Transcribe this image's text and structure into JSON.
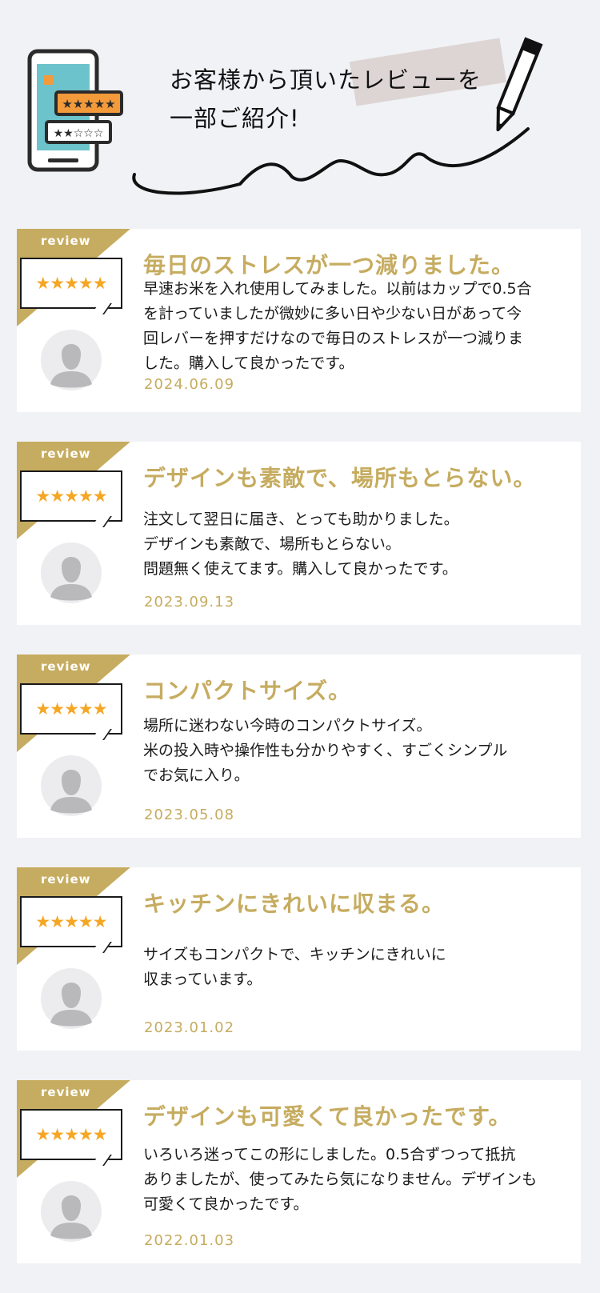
{
  "header": {
    "title_line1": "お客様から頂いたレビューを",
    "title_line2": "一部ご紹介!"
  },
  "reviews": [
    {
      "tag": "review",
      "stars": "★★★★★",
      "headline": "毎日のストレスが一つ減りました。",
      "lines": [
        "早速お米を入れ使用してみました。以前はカップで0.5合",
        "を計っていましたが微妙に多い日や少ない日があって今",
        "回レバーを押すだけなので毎日のストレスが一つ減りま",
        "した。購入して良かったです。"
      ],
      "date": "2024.06.09"
    },
    {
      "tag": "review",
      "stars": "★★★★★",
      "headline": "デザインも素敵で、場所もとらない。",
      "lines": [
        "注文して翌日に届き、とっても助かりました。",
        "デザインも素敵で、場所もとらない。",
        "問題無く使えてます。購入して良かったです。"
      ],
      "date": "2023.09.13"
    },
    {
      "tag": "review",
      "stars": "★★★★★",
      "headline": "コンパクトサイズ。",
      "lines": [
        "場所に迷わない今時のコンパクトサイズ。",
        "米の投入時や操作性も分かりやすく、すごくシンプル",
        "でお気に入り。"
      ],
      "date": "2023.05.08"
    },
    {
      "tag": "review",
      "stars": "★★★★★",
      "headline": "キッチンにきれいに収まる。",
      "lines": [
        "サイズもコンパクトで、キッチンにきれいに",
        "収まっています。"
      ],
      "date": "2023.01.02"
    },
    {
      "tag": "review",
      "stars": "★★★★★",
      "headline": "デザインも可愛くて良かったです。",
      "lines": [
        "いろいろ迷ってこの形にしました。0.5合ずつって抵抗",
        "ありましたが、使ってみたら気になりません。デザインも",
        "可愛くて良かったです。"
      ],
      "date": "2022.01.03"
    }
  ]
}
